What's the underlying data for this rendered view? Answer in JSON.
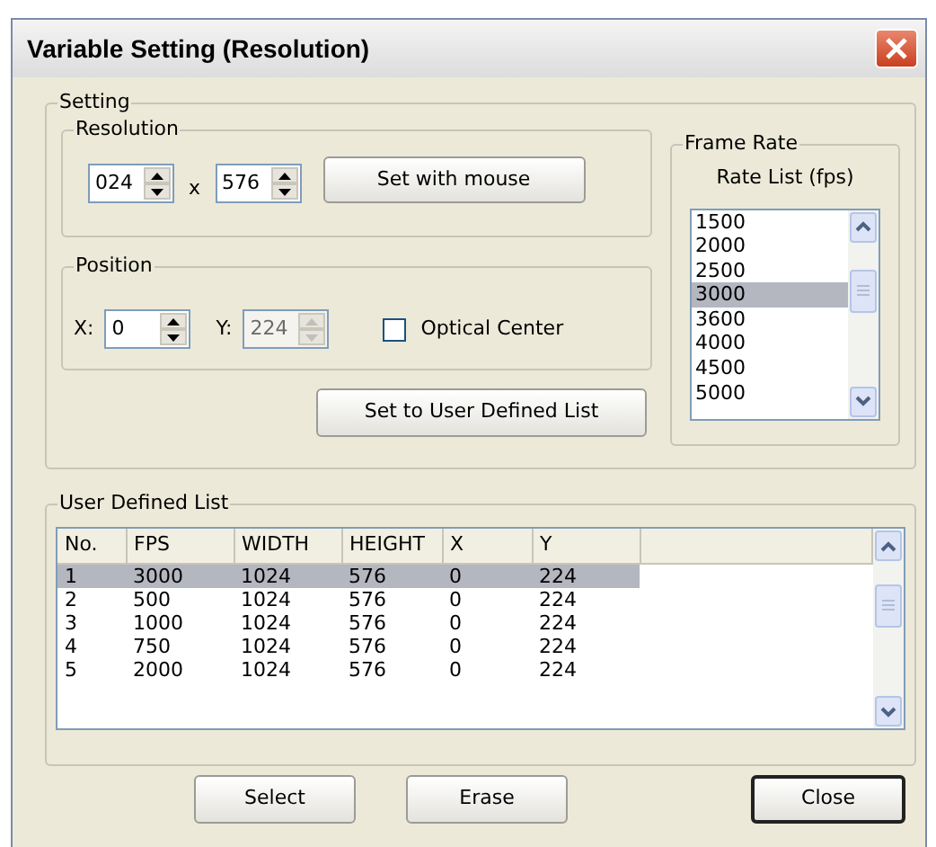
{
  "window": {
    "title": "Variable Setting (Resolution)"
  },
  "setting": {
    "label": "Setting",
    "resolution": {
      "label": "Resolution",
      "width": {
        "value": "024",
        "disabled": false
      },
      "separator": "x",
      "height": {
        "value": "576",
        "disabled": false
      },
      "set_button": "Set with mouse"
    },
    "position": {
      "label": "Position",
      "fields": [
        {
          "label": "X:",
          "value": "0",
          "disabled": false
        },
        {
          "label": "Y:",
          "value": "224",
          "disabled": true
        }
      ],
      "optical_center": {
        "label": "Optical Center",
        "checked": false
      }
    },
    "set_to_list_button": "Set to User Defined List",
    "frame_rate": {
      "label": "Frame Rate",
      "list_label": "Rate List (fps)",
      "items": [
        {
          "label": "1500",
          "selected": false
        },
        {
          "label": "2000",
          "selected": false
        },
        {
          "label": "2500",
          "selected": false
        },
        {
          "label": "3000",
          "selected": true
        },
        {
          "label": "3600",
          "selected": false
        },
        {
          "label": "4000",
          "selected": false
        },
        {
          "label": "4500",
          "selected": false
        },
        {
          "label": "5000",
          "selected": false
        }
      ]
    }
  },
  "user_list": {
    "label": "User Defined List",
    "columns": [
      "No.",
      "FPS",
      "WIDTH",
      "HEIGHT",
      "X",
      "Y"
    ],
    "rows": [
      {
        "cells": [
          "1",
          "3000",
          "1024",
          "576",
          "0",
          "224"
        ],
        "selected": true
      },
      {
        "cells": [
          "2",
          "500",
          "1024",
          "576",
          "0",
          "224"
        ],
        "selected": false
      },
      {
        "cells": [
          "3",
          "1000",
          "1024",
          "576",
          "0",
          "224"
        ],
        "selected": false
      },
      {
        "cells": [
          "4",
          "750",
          "1024",
          "576",
          "0",
          "224"
        ],
        "selected": false
      },
      {
        "cells": [
          "5",
          "2000",
          "1024",
          "576",
          "0",
          "224"
        ],
        "selected": false
      }
    ]
  },
  "buttons": [
    {
      "label": "Select",
      "default": false
    },
    {
      "label": "Erase",
      "default": false
    },
    {
      "label": "Close",
      "default": true
    }
  ]
}
